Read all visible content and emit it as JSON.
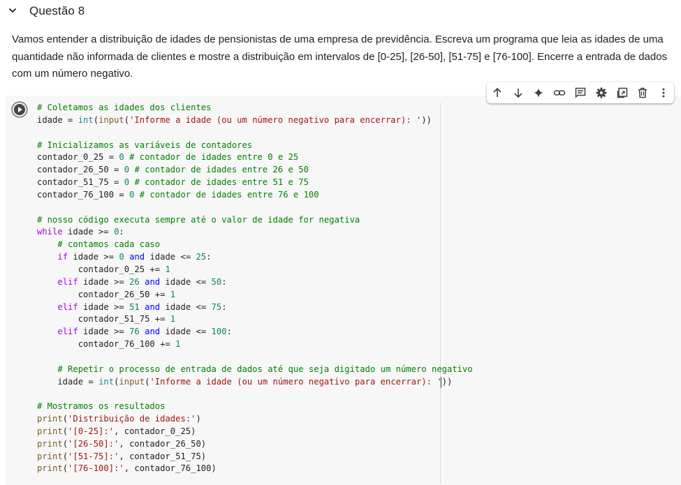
{
  "section": {
    "title": "Questão 8",
    "chevron_icon": "chevron-down-icon"
  },
  "description": "Vamos entender a distribuição de idades de pensionistas de uma empresa de previdência. Escreva um programa que leia as idades de uma quantidade não informada de clientes e mostre a distribuição em intervalos de [0-25], [26-50], [51-75] e [76-100]. Encerre a entrada de dados com um número negativo.",
  "toolbar": {
    "buttons": [
      {
        "name": "move-cell-up-button",
        "icon": "arrow-up-icon"
      },
      {
        "name": "move-cell-down-button",
        "icon": "arrow-down-icon"
      },
      {
        "name": "gemini-button",
        "icon": "sparkle-icon"
      },
      {
        "name": "copy-link-button",
        "icon": "link-icon"
      },
      {
        "name": "add-comment-button",
        "icon": "comment-icon"
      },
      {
        "name": "cell-settings-button",
        "icon": "gear-icon"
      },
      {
        "name": "mirror-cell-button",
        "icon": "mirror-cell-icon"
      },
      {
        "name": "delete-cell-button",
        "icon": "trash-icon"
      },
      {
        "name": "more-actions-button",
        "icon": "more-vert-icon"
      }
    ]
  },
  "cell": {
    "run_button_icon": "play-circle-icon",
    "code_lines": [
      [
        [
          "cm",
          "# Coletamos as idades dos clientes"
        ]
      ],
      [
        [
          "",
          "idade = "
        ],
        [
          "bi",
          "int"
        ],
        [
          "",
          "("
        ],
        [
          "fn",
          "input"
        ],
        [
          "",
          "("
        ],
        [
          "str",
          "'Informe a idade (ou um número negativo para encerrar): '"
        ],
        [
          "",
          "))"
        ]
      ],
      [
        [
          "",
          ""
        ]
      ],
      [
        [
          "cm",
          "# Inicializamos as variáveis de contadores"
        ]
      ],
      [
        [
          "",
          "contador_0_25 = "
        ],
        [
          "num",
          "0"
        ],
        [
          "",
          " "
        ],
        [
          "cm",
          "# contador de idades entre 0 e 25"
        ]
      ],
      [
        [
          "",
          "contador_26_50 = "
        ],
        [
          "num",
          "0"
        ],
        [
          "",
          " "
        ],
        [
          "cm",
          "# contador de idades entre 26 e 50"
        ]
      ],
      [
        [
          "",
          "contador_51_75 = "
        ],
        [
          "num",
          "0"
        ],
        [
          "",
          " "
        ],
        [
          "cm",
          "# contador de idades entre 51 e 75"
        ]
      ],
      [
        [
          "",
          "contador_76_100 = "
        ],
        [
          "num",
          "0"
        ],
        [
          "",
          " "
        ],
        [
          "cm",
          "# contador de idades entre 76 e 100"
        ]
      ],
      [
        [
          "",
          ""
        ]
      ],
      [
        [
          "cm",
          "# nosso código executa sempre até o valor de idade for negativa"
        ]
      ],
      [
        [
          "kw",
          "while"
        ],
        [
          "",
          " idade >= "
        ],
        [
          "num",
          "0"
        ],
        [
          "",
          ":"
        ]
      ],
      [
        [
          "",
          "    "
        ],
        [
          "cm",
          "# contamos cada caso"
        ]
      ],
      [
        [
          "",
          "    "
        ],
        [
          "kw",
          "if"
        ],
        [
          "",
          " idade >= "
        ],
        [
          "num",
          "0"
        ],
        [
          "",
          " "
        ],
        [
          "kb",
          "and"
        ],
        [
          "",
          " idade <= "
        ],
        [
          "num",
          "25"
        ],
        [
          "",
          ":"
        ]
      ],
      [
        [
          "",
          "        contador_0_25 += "
        ],
        [
          "num",
          "1"
        ]
      ],
      [
        [
          "",
          "    "
        ],
        [
          "kw",
          "elif"
        ],
        [
          "",
          " idade >= "
        ],
        [
          "num",
          "26"
        ],
        [
          "",
          " "
        ],
        [
          "kb",
          "and"
        ],
        [
          "",
          " idade <= "
        ],
        [
          "num",
          "50"
        ],
        [
          "",
          ":"
        ]
      ],
      [
        [
          "",
          "        contador_26_50 += "
        ],
        [
          "num",
          "1"
        ]
      ],
      [
        [
          "",
          "    "
        ],
        [
          "kw",
          "elif"
        ],
        [
          "",
          " idade >= "
        ],
        [
          "num",
          "51"
        ],
        [
          "",
          " "
        ],
        [
          "kb",
          "and"
        ],
        [
          "",
          " idade <= "
        ],
        [
          "num",
          "75"
        ],
        [
          "",
          ":"
        ]
      ],
      [
        [
          "",
          "        contador_51_75 += "
        ],
        [
          "num",
          "1"
        ]
      ],
      [
        [
          "",
          "    "
        ],
        [
          "kw",
          "elif"
        ],
        [
          "",
          " idade >= "
        ],
        [
          "num",
          "76"
        ],
        [
          "",
          " "
        ],
        [
          "kb",
          "and"
        ],
        [
          "",
          " idade <= "
        ],
        [
          "num",
          "100"
        ],
        [
          "",
          ":"
        ]
      ],
      [
        [
          "",
          "        contador_76_100 += "
        ],
        [
          "num",
          "1"
        ]
      ],
      [
        [
          "",
          ""
        ]
      ],
      [
        [
          "",
          "    "
        ],
        [
          "cm",
          "# Repetir o processo de entrada de dados até que seja digitado um número negativo"
        ]
      ],
      [
        [
          "",
          "    idade = "
        ],
        [
          "bi",
          "int"
        ],
        [
          "",
          "("
        ],
        [
          "fn",
          "input"
        ],
        [
          "",
          "("
        ],
        [
          "str",
          "'Informe a idade (ou um número negativo para encerrar): '"
        ],
        [
          "",
          "))"
        ]
      ],
      [
        [
          "",
          ""
        ]
      ],
      [
        [
          "cm",
          "# Mostramos os resultados"
        ]
      ],
      [
        [
          "fn",
          "print"
        ],
        [
          "",
          "("
        ],
        [
          "str",
          "'Distribuição de idades:'"
        ],
        [
          "",
          ")"
        ]
      ],
      [
        [
          "fn",
          "print"
        ],
        [
          "",
          "("
        ],
        [
          "str",
          "'[0-25]:'"
        ],
        [
          "",
          ", contador_0_25)"
        ]
      ],
      [
        [
          "fn",
          "print"
        ],
        [
          "",
          "("
        ],
        [
          "str",
          "'[26-50]:'"
        ],
        [
          "",
          ", contador_26_50)"
        ]
      ],
      [
        [
          "fn",
          "print"
        ],
        [
          "",
          "("
        ],
        [
          "str",
          "'[51-75]:'"
        ],
        [
          "",
          ", contador_51_75)"
        ]
      ],
      [
        [
          "fn",
          "print"
        ],
        [
          "",
          "("
        ],
        [
          "str",
          "'[76-100]:'"
        ],
        [
          "",
          ", contador_76_100)"
        ]
      ]
    ]
  }
}
